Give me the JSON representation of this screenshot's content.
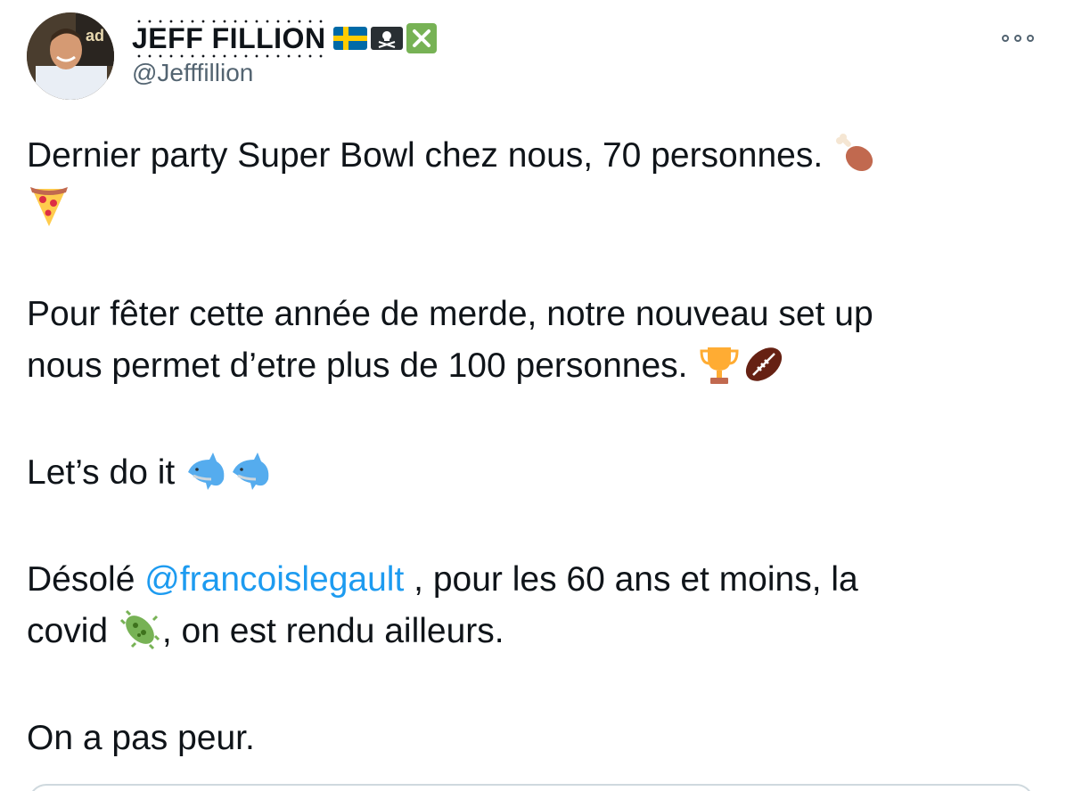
{
  "author": {
    "display_name": "JEFF FILLION",
    "handle": "@Jefffillion",
    "name_emojis": [
      "flag-sweden-icon",
      "skull-crossbones-icon",
      "cross-mark-icon"
    ]
  },
  "menu": {
    "more_icon": "more-icon"
  },
  "tweet": {
    "p1_text": "Dernier party Super Bowl chez nous, 70 personnes.",
    "p1_emojis": [
      "poultry-leg-icon",
      "pizza-icon"
    ],
    "p2_line1": "Pour fêter cette année de merde, notre nouveau set up",
    "p2_line2": "nous permet d’etre plus de 100 personnes.",
    "p2_emojis": [
      "trophy-icon",
      "american-football-icon"
    ],
    "p3_text": "Let’s do it",
    "p3_emojis": [
      "dolphin-icon",
      "dolphin-icon"
    ],
    "p4_before": "Désolé ",
    "p4_mention": "@francoislegault",
    "p4_after": " , pour les 60 ans et moins, la",
    "p4_line2_before": "covid ",
    "p4_line2_after": ", on est rendu ailleurs.",
    "p4_emojis": [
      "microbe-icon"
    ],
    "p5_text": "On a pas peur."
  },
  "colors": {
    "link": "#1d9bf0",
    "text": "#0f1419",
    "secondary": "#536471"
  }
}
